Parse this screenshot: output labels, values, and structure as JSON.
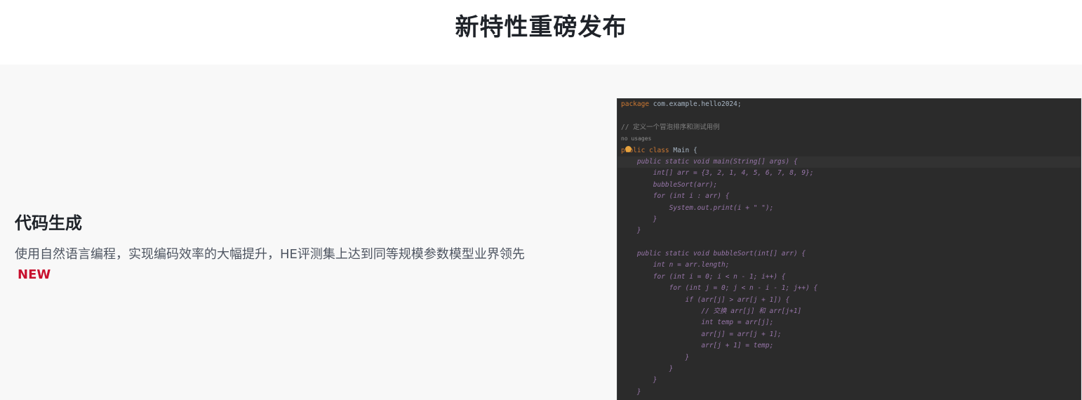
{
  "header": {
    "title": "新特性重磅发布"
  },
  "feature": {
    "title": "代码生成",
    "description": "使用自然语言编程，实现编码效率的大幅提升，HE评测集上达到同等规模参数模型业界领先",
    "badge": "NEW"
  },
  "code_panel": {
    "package_keyword": "package",
    "package_name": " com.example.hello2024;",
    "comment_define": "// 定义一个冒泡排序和测试用例",
    "usages": "no usages",
    "class_keywords": "public class",
    "class_name": " Main {",
    "lines": [
      "    public static void main(String[] args) {",
      "        int[] arr = {3, 2, 1, 4, 5, 6, 7, 8, 9};",
      "        bubbleSort(arr);",
      "        for (int i : arr) {",
      "            System.out.print(i + \" \");",
      "        }",
      "    }",
      "",
      "    public static void bubbleSort(int[] arr) {",
      "        int n = arr.length;",
      "        for (int i = 0; i < n - 1; i++) {",
      "            for (int j = 0; j < n - i - 1; j++) {",
      "                if (arr[j] > arr[j + 1]) {",
      "                    // 交换 arr[j] 和 arr[j+1]",
      "                    int temp = arr[j];",
      "                    arr[j] = arr[j + 1];",
      "                    arr[j + 1] = temp;",
      "                }",
      "            }",
      "        }",
      "    }"
    ]
  }
}
